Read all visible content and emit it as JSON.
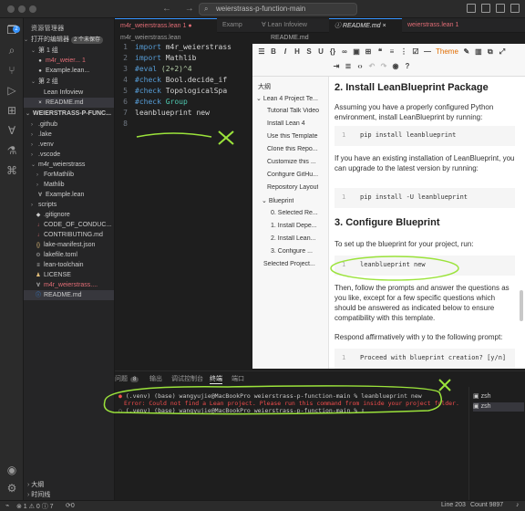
{
  "window": {
    "search_text": "weierstrass-p-function-main"
  },
  "sidebar": {
    "explorer_title": "资源管理器",
    "open_editors": {
      "label": "打开的编辑器",
      "badge": "2 个未保存"
    },
    "group1": {
      "label": "第 1 组",
      "files": [
        "m4r_weier...  1",
        "Example.lean..."
      ]
    },
    "group2": {
      "label": "第 2 组",
      "files": [
        "Lean Infoview",
        "README.md"
      ]
    },
    "project": {
      "label": "WEIERSTRASS-P-FUNC..."
    },
    "tree": [
      ".github",
      ".lake",
      ".venv",
      ".vscode",
      "m4r_weierstrass",
      "ForMathlib",
      "Mathlib",
      "Example.lean",
      "scripts",
      ".gitignore",
      "CODE_OF_CONDUC...",
      "CONTRIBUTING.md",
      "lake-manifest.json",
      "lakefile.toml",
      "lean-toolchain",
      "LICENSE",
      "m4r_weierstrass....",
      "README.md"
    ],
    "outline_label": "大纲",
    "timeline_label": "时间线"
  },
  "editor1": {
    "tabs": [
      "m4r_weierstrass.lean 1",
      "Examp"
    ],
    "breadcrumb": "m4r_weierstrass.lean",
    "lines": [
      {
        "n": "1",
        "a": "import",
        "b": " m4r_weierstrass"
      },
      {
        "n": "2",
        "a": "import",
        "b": " Mathlib"
      },
      {
        "n": "3",
        "a": "#eval",
        "b": " (2+2)^4"
      },
      {
        "n": "4",
        "a": "#check",
        "b": " Bool.decide_if"
      },
      {
        "n": "5",
        "a": "#check",
        "b": " TopologicalSpa"
      },
      {
        "n": "6",
        "a": "#check",
        "b": " Group"
      },
      {
        "n": "7",
        "a": "leanblueprint",
        "b": " new"
      },
      {
        "n": "8",
        "a": "",
        "b": ""
      }
    ]
  },
  "editor2": {
    "tabs": [
      "Lean Infoview",
      "README.md",
      "weierstrass.lean 1"
    ],
    "preview_title": "README.md"
  },
  "markdown": {
    "toolbar_theme": "Theme",
    "outline_title": "大纲",
    "outline": [
      "Lean 4 Project Te...",
      "Tutorial Talk Video",
      "Install Lean 4",
      "Use this Template",
      "Clone this Repo...",
      "Customize this ...",
      "Configure GitHu...",
      "Repository Layout",
      "Blueprint",
      "0. Selected Re...",
      "1. Install Depe...",
      "2. Install Lean...",
      "3. Configure ...",
      "Selected Project..."
    ],
    "h_install": "2. Install LeanBlueprint Package",
    "p_assuming": "Assuming you have a properly configured Python environment, install LeanBlueprint by running:",
    "code_install": "pip install leanblueprint",
    "p_existing": "If you have an existing installation of LeanBlueprint, you can upgrade to the latest version by running:",
    "code_upgrade": "pip install -U leanblueprint",
    "h_configure": "3. Configure Blueprint",
    "p_setup": "To set up the blueprint for your project, run:",
    "code_new": "leanblueprint new",
    "p_follow": "Then, follow the prompts and answer the questions as you like, except for a few specific questions which should be answered as indicated below to ensure compatibility with this template.",
    "p_respond": "Respond affirmatively with y to the following prompt:",
    "code_proceed": "Proceed with blueprint creation? [y/n]",
    "code_ln": "1"
  },
  "panel": {
    "tabs": [
      "问题",
      "输出",
      "调试控制台",
      "终端",
      "端口"
    ],
    "problems_count": "8",
    "term_lines": [
      "(.venv) (base) wangyujie@MacBookPro weierstrass-p-function-main % leanblueprint new",
      "Error: Could not find a Lean project. Please run this command from inside your project folder.",
      "(.venv) (base) wangyujie@MacBookPro weierstrass-p-function-main %"
    ],
    "terminals": [
      "zsh",
      "zsh"
    ]
  },
  "status": {
    "left": "⊗ 1 ⚠ 0 ⓘ 7",
    "sync": "0",
    "right_line": "Line 203",
    "right_count": "Count 9897"
  },
  "colors": {
    "accent": "#3794ff",
    "annotation": "#9be33b",
    "error": "#f14c4c"
  }
}
